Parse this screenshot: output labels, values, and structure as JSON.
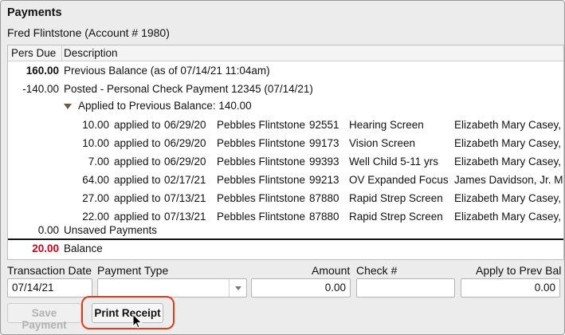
{
  "header": {
    "title": "Payments",
    "account": "Fred Flintstone (Account # 1980)"
  },
  "table": {
    "columns": [
      "Pers Due",
      "Description"
    ],
    "previous_balance": {
      "amount": "160.00",
      "text": "Previous Balance (as of 07/14/21 11:04am)"
    },
    "posted": {
      "amount": "-140.00",
      "text": "Posted - Personal Check Payment 12345 (07/14/21)"
    },
    "applied_header": "Applied to Previous Balance: 140.00",
    "applied_rows": [
      {
        "amount": "10.00",
        "applied_to": "applied to",
        "date": "06/29/20",
        "patient": "Pebbles Flintstone",
        "code": "92551",
        "service": "Hearing Screen",
        "provider": "Elizabeth Mary Casey,"
      },
      {
        "amount": "10.00",
        "applied_to": "applied to",
        "date": "06/29/20",
        "patient": "Pebbles Flintstone",
        "code": "99173",
        "service": "Vision Screen",
        "provider": "Elizabeth Mary Casey,"
      },
      {
        "amount": "7.00",
        "applied_to": "applied to",
        "date": "06/29/20",
        "patient": "Pebbles Flintstone",
        "code": "99393",
        "service": "Well Child 5-11 yrs",
        "provider": "Elizabeth Mary Casey,"
      },
      {
        "amount": "64.00",
        "applied_to": "applied to",
        "date": "02/17/21",
        "patient": "Pebbles Flintstone",
        "code": "99213",
        "service": "OV Expanded Focus",
        "provider": "James Davidson, Jr. M"
      },
      {
        "amount": "27.00",
        "applied_to": "applied to",
        "date": "07/13/21",
        "patient": "Pebbles Flintstone",
        "code": "87880",
        "service": "Rapid Strep Screen",
        "provider": "Elizabeth Mary Casey,"
      },
      {
        "amount": "22.00",
        "applied_to": "applied to",
        "date": "07/13/21",
        "patient": "Pebbles Flintstone",
        "code": "87880",
        "service": "Rapid Strep Screen",
        "provider": "Elizabeth Mary Casey,"
      }
    ],
    "unsaved": {
      "amount": "0.00",
      "text": "Unsaved Payments"
    },
    "balance": {
      "amount": "20.00",
      "text": "Balance"
    }
  },
  "form": {
    "transaction_date_label": "Transaction Date",
    "transaction_date_value": "07/14/21",
    "payment_type_label": "Payment Type",
    "payment_type_value": "",
    "amount_label": "Amount",
    "amount_value": "0.00",
    "check_label": "Check #",
    "check_value": "",
    "apply_label": "Apply to Prev Bal",
    "apply_value": "0.00"
  },
  "buttons": {
    "save": "Save Payment",
    "print": "Print Receipt"
  },
  "colors": {
    "balance_red": "#d0021b",
    "highlight": "#e03c1c"
  }
}
